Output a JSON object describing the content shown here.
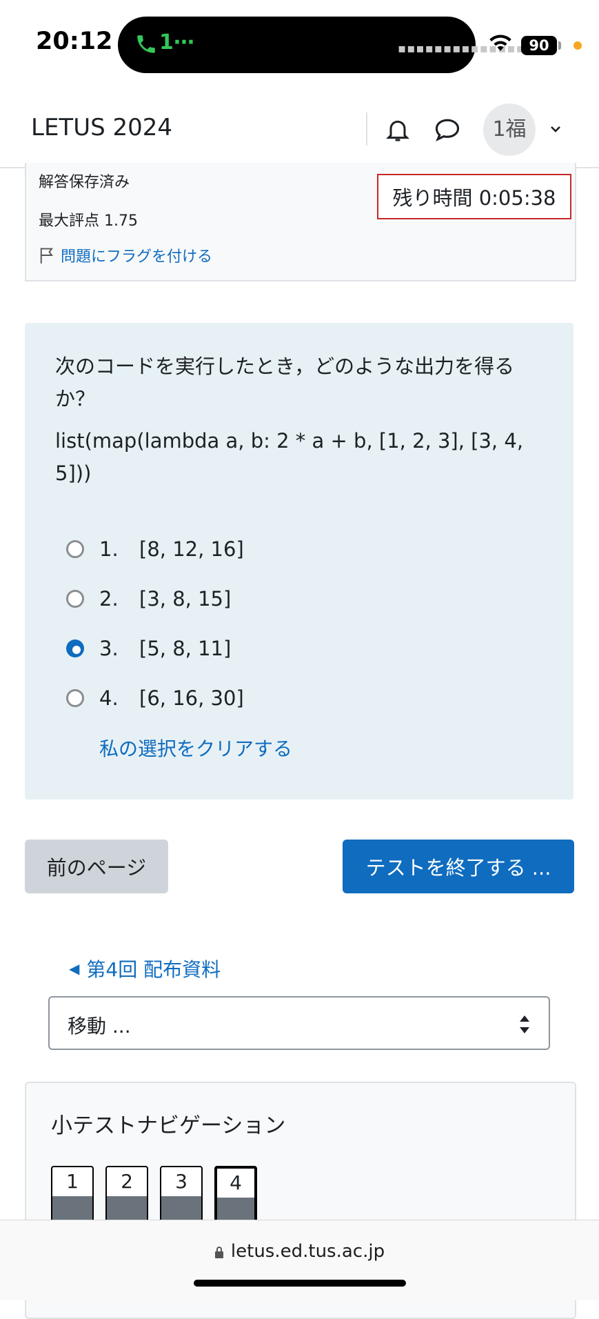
{
  "status_bar": {
    "time": "20:12",
    "call_indicator": "1⋯",
    "battery": "90",
    "accent_green": "#34c759"
  },
  "navbar": {
    "brand": "LETUS 2024",
    "avatar_initials": "1福"
  },
  "question_info": {
    "status": "解答保存済み",
    "max_grade": "最大評点 1.75",
    "flag_label": "問題にフラグを付ける"
  },
  "timer": {
    "text": "残り時間 0:05:38",
    "border_color": "#c62828"
  },
  "question": {
    "text": "次のコードを実行したとき，どのような出力を得るか？",
    "code": "list(map(lambda a, b: 2 * a + b, [1, 2, 3], [3, 4, 5]))",
    "options": [
      {
        "num": "1.",
        "label": "[8, 12, 16]",
        "selected": false
      },
      {
        "num": "2.",
        "label": "[3, 8, 15]",
        "selected": false
      },
      {
        "num": "3.",
        "label": "[5, 8, 11]",
        "selected": true
      },
      {
        "num": "4.",
        "label": "[6, 16, 30]",
        "selected": false
      }
    ],
    "clear_label": "私の選択をクリアする"
  },
  "buttons": {
    "prev": "前のページ",
    "finish": "テストを終了する ..."
  },
  "activity_nav": {
    "prev_link": "第4回 配布資料",
    "jump_placeholder": "移動 ..."
  },
  "quiz_nav": {
    "title": "小テストナビゲーション",
    "items": [
      "1",
      "2",
      "3",
      "4"
    ],
    "current": "4"
  },
  "browser": {
    "url": "letus.ed.tus.ac.jp"
  },
  "colors": {
    "link": "#0f6cbf",
    "question_bg": "#e7f1f5"
  }
}
